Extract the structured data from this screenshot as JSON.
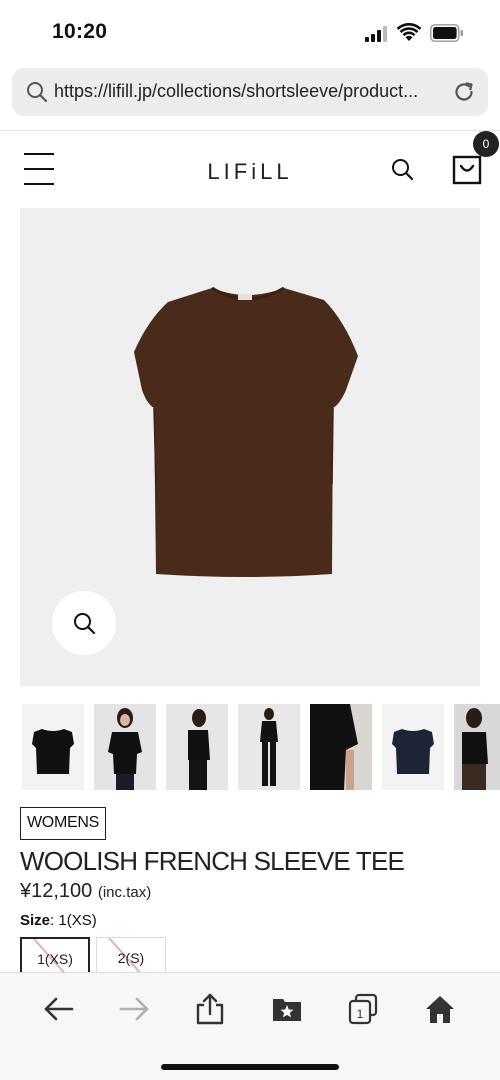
{
  "status_bar": {
    "time": "10:20"
  },
  "browser": {
    "url": "https://lifill.jp/collections/shortsleeve/product..."
  },
  "header": {
    "logo": "LIFiLL",
    "cart_count": "0"
  },
  "product": {
    "category": "WOMENS",
    "title": "WOOLISH FRENCH SLEEVE TEE",
    "price": "¥12,100",
    "tax_note": "(inc.tax)",
    "size_label": "Size",
    "size_value": ": 1(XS)",
    "sizes": [
      {
        "label": "1(XS)",
        "selected": true,
        "sold_out": true
      },
      {
        "label": "2(S)",
        "selected": false,
        "sold_out": true
      }
    ],
    "main_color": "#4a2a1a",
    "thumbnails": [
      "black-tee-flat",
      "model-front",
      "model-side",
      "model-full",
      "model-sleeve-closeup",
      "navy-tee-flat",
      "model-partial"
    ]
  }
}
